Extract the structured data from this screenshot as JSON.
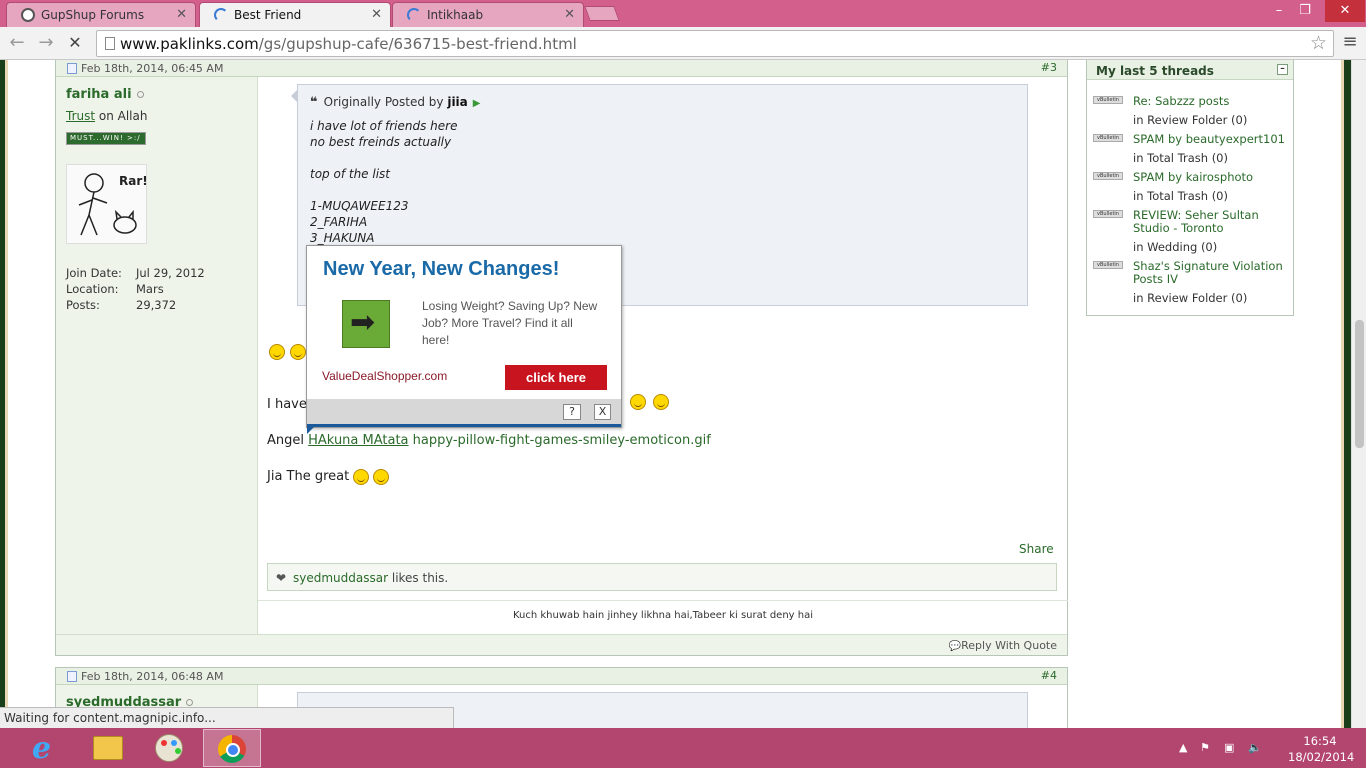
{
  "browser": {
    "tabs": [
      {
        "label": "GupShup Forums",
        "active": false
      },
      {
        "label": "Best Friend",
        "active": true
      },
      {
        "label": "Intikhaab",
        "active": false
      }
    ],
    "url_host": "www.paklinks.com",
    "url_path": "/gs/gupshup-cafe/636715-best-friend.html",
    "status_text": "Waiting for content.magnipic.info..."
  },
  "post3": {
    "date": "Feb 18th, 2014, 06:45 AM",
    "number": "#3",
    "user": {
      "name": "fariha ali",
      "title_link": "Trust",
      "title_rest": " on Allah",
      "rank_badge": "MUST...WIN! >:/",
      "avatar_text": "Rar!",
      "stats": [
        {
          "label": "Join Date:",
          "value": "Jul 29, 2012"
        },
        {
          "label": "Location:",
          "value": "Mars"
        },
        {
          "label": "Posts:",
          "value": "29,372"
        }
      ]
    },
    "quote": {
      "prefix": "Originally Posted by",
      "author": "jiia",
      "lines": [
        "i have lot of friends here",
        "no best freinds actually",
        "",
        "top of the list",
        "",
        "1-MUQAWEE123",
        "2_FARIHA",
        "3_HAKUNA"
      ]
    },
    "message": {
      "line1": "I have",
      "line2_prefix": "Angel",
      "line2_link": "HAkuna MAtata",
      "line2_rest": "happy-pillow-fight-games-smiley-emoticon.gif",
      "line3": "Jia The great"
    },
    "share_label": "Share",
    "likes_user": "syedmuddassar",
    "likes_text": "likes this.",
    "signature": "Kuch khuwab hain jinhey likhna hai,Tabeer ki surat deny hai",
    "reply_label": "Reply With Quote"
  },
  "post4": {
    "date": "Feb 18th, 2014, 06:48 AM",
    "number": "#4",
    "user_name": "syedmuddassar"
  },
  "sidebar": {
    "title": "My last 5 threads",
    "collapse_glyph": "–",
    "threads": [
      {
        "title": "Re: Sabzzz posts",
        "forum": "in Review Folder (0)"
      },
      {
        "title": "SPAM by beautyexpert101",
        "forum": "in Total Trash (0)"
      },
      {
        "title": "SPAM by kairosphoto",
        "forum": "in Total Trash (0)"
      },
      {
        "title": "REVIEW: Seher Sultan Studio - Toronto",
        "forum": "in Wedding (0)"
      },
      {
        "title": "Shaz's Signature Violation Posts IV",
        "forum": "in Review Folder (0)"
      }
    ],
    "thread_icon_label": "vBulletin"
  },
  "ad": {
    "title": "New Year, New Changes!",
    "body": "Losing Weight? Saving Up? New Job? More Travel? Find it all here!",
    "domain": "ValueDealShopper.com",
    "cta": "click here",
    "help": "?",
    "close": "X"
  },
  "taskbar": {
    "time": "16:54",
    "date": "18/02/2014"
  },
  "colors": {
    "accent_green": "#2b6a2b",
    "ad_title": "#1a6aa8",
    "ad_button": "#c8141e",
    "taskbar": "#b2466e"
  }
}
